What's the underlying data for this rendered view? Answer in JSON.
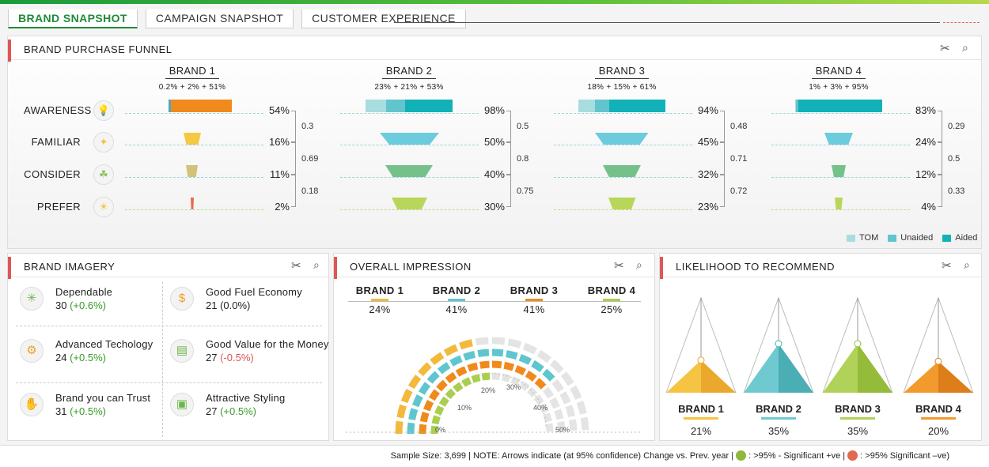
{
  "tabs": [
    {
      "label": "BRAND SNAPSHOT",
      "active": true
    },
    {
      "label": "CAMPAIGN SNAPSHOT",
      "active": false
    },
    {
      "label": "CUSTOMER EXPERIENCE",
      "active": false
    }
  ],
  "funnel": {
    "title": "BRAND PURCHASE FUNNEL",
    "rows": [
      "AWARENESS",
      "FAMILIAR",
      "CONSIDER",
      "PREFER"
    ],
    "brands": [
      {
        "name": "BRAND 1",
        "breakdown": "0.2% + 2% + 51%",
        "awareness": {
          "tom": 0.2,
          "unaided": 2,
          "aided": 51
        },
        "values": [
          "54%",
          "16%",
          "11%",
          "2%"
        ],
        "ratios": [
          "0.3",
          "0.69",
          "0.18"
        ]
      },
      {
        "name": "BRAND 2",
        "breakdown": "23% + 21% + 53%",
        "awareness": {
          "tom": 23,
          "unaided": 21,
          "aided": 53
        },
        "values": [
          "98%",
          "50%",
          "40%",
          "30%"
        ],
        "ratios": [
          "0.5",
          "0.8",
          "0.75"
        ]
      },
      {
        "name": "BRAND 3",
        "breakdown": "18% + 15% + 61%",
        "awareness": {
          "tom": 18,
          "unaided": 15,
          "aided": 61
        },
        "values": [
          "94%",
          "45%",
          "32%",
          "23%"
        ],
        "ratios": [
          "0.48",
          "0.71",
          "0.72"
        ]
      },
      {
        "name": "BRAND 4",
        "breakdown": "1% + 3% + 95%",
        "awareness": {
          "tom": 1,
          "unaided": 3,
          "aided": 95
        },
        "values": [
          "83%",
          "24%",
          "12%",
          "4%"
        ],
        "ratios": [
          "0.29",
          "0.5",
          "0.33"
        ]
      }
    ],
    "legend": [
      "TOM",
      "Unaided",
      "Aided"
    ],
    "colors": {
      "tom": "#a8dde0",
      "unaided": "#62c4cc",
      "aided": "#12b1b8",
      "brand1_aware": "#f08a1c",
      "familiar": "#6ccbdc",
      "consider": "#74c28a",
      "prefer": "#b8d65a",
      "b1_familiar": "#f5c842",
      "b1_consider": "#d4c27a",
      "b1_prefer": "#e86a4a"
    }
  },
  "imagery": {
    "title": "BRAND IMAGERY",
    "items": [
      {
        "name": "Dependable",
        "value": "30",
        "change": "(+0.6%)",
        "dir": "pos",
        "icon": "network-icon"
      },
      {
        "name": "Good Fuel Economy",
        "value": "21",
        "change": "(0.0%)",
        "dir": "neutral",
        "icon": "fuel-coin-icon"
      },
      {
        "name": "Advanced Techology",
        "value": "24",
        "change": "(+0.5%)",
        "dir": "pos",
        "icon": "gear-cycle-icon"
      },
      {
        "name": "Good Value for the Money",
        "value": "27",
        "change": "(-0.5%)",
        "dir": "neg",
        "icon": "money-icon"
      },
      {
        "name": "Brand you can Trust",
        "value": "31",
        "change": "(+0.5%)",
        "dir": "pos",
        "icon": "handshake-icon"
      },
      {
        "name": "Attractive Styling",
        "value": "27",
        "change": "(+0.5%)",
        "dir": "pos",
        "icon": "gift-box-icon"
      }
    ]
  },
  "impression": {
    "title": "OVERALL IMPRESSION",
    "brands": [
      {
        "name": "BRAND 1",
        "pct": "24%",
        "value": 24,
        "color": "#f3b93a"
      },
      {
        "name": "BRAND 2",
        "pct": "41%",
        "value": 41,
        "color": "#5fc6cf"
      },
      {
        "name": "BRAND 3",
        "pct": "41%",
        "value": 41,
        "color": "#f08a1c"
      },
      {
        "name": "BRAND 4",
        "pct": "25%",
        "value": 25,
        "color": "#a9cf4a"
      }
    ],
    "scale": [
      "0%",
      "10%",
      "20%",
      "30%",
      "40%",
      "50%"
    ]
  },
  "recommend": {
    "title": "LIKELIHOOD TO RECOMMEND",
    "brands": [
      {
        "name": "BRAND 1",
        "pct": "21%",
        "value": 21,
        "color": "#f6c443",
        "dark": "#eaa92c"
      },
      {
        "name": "BRAND 2",
        "pct": "35%",
        "value": 35,
        "color": "#6ecad0",
        "dark": "#4aaeb4"
      },
      {
        "name": "BRAND 3",
        "pct": "35%",
        "value": 35,
        "color": "#b1d258",
        "dark": "#95bb3a"
      },
      {
        "name": "BRAND 4",
        "pct": "20%",
        "value": 20,
        "color": "#f39a2e",
        "dark": "#dd7e1a"
      }
    ]
  },
  "footer": {
    "sample": "Sample Size: 3,699 |",
    "note": "NOTE:  Arrows indicate (at 95% confidence) Change vs. Prev. year |",
    "pos_label": ": >95% - Significant +ve |",
    "neg_label": ": >95% Significant –ve)",
    "pos_color": "#8fb83a",
    "neg_color": "#e06a50"
  }
}
